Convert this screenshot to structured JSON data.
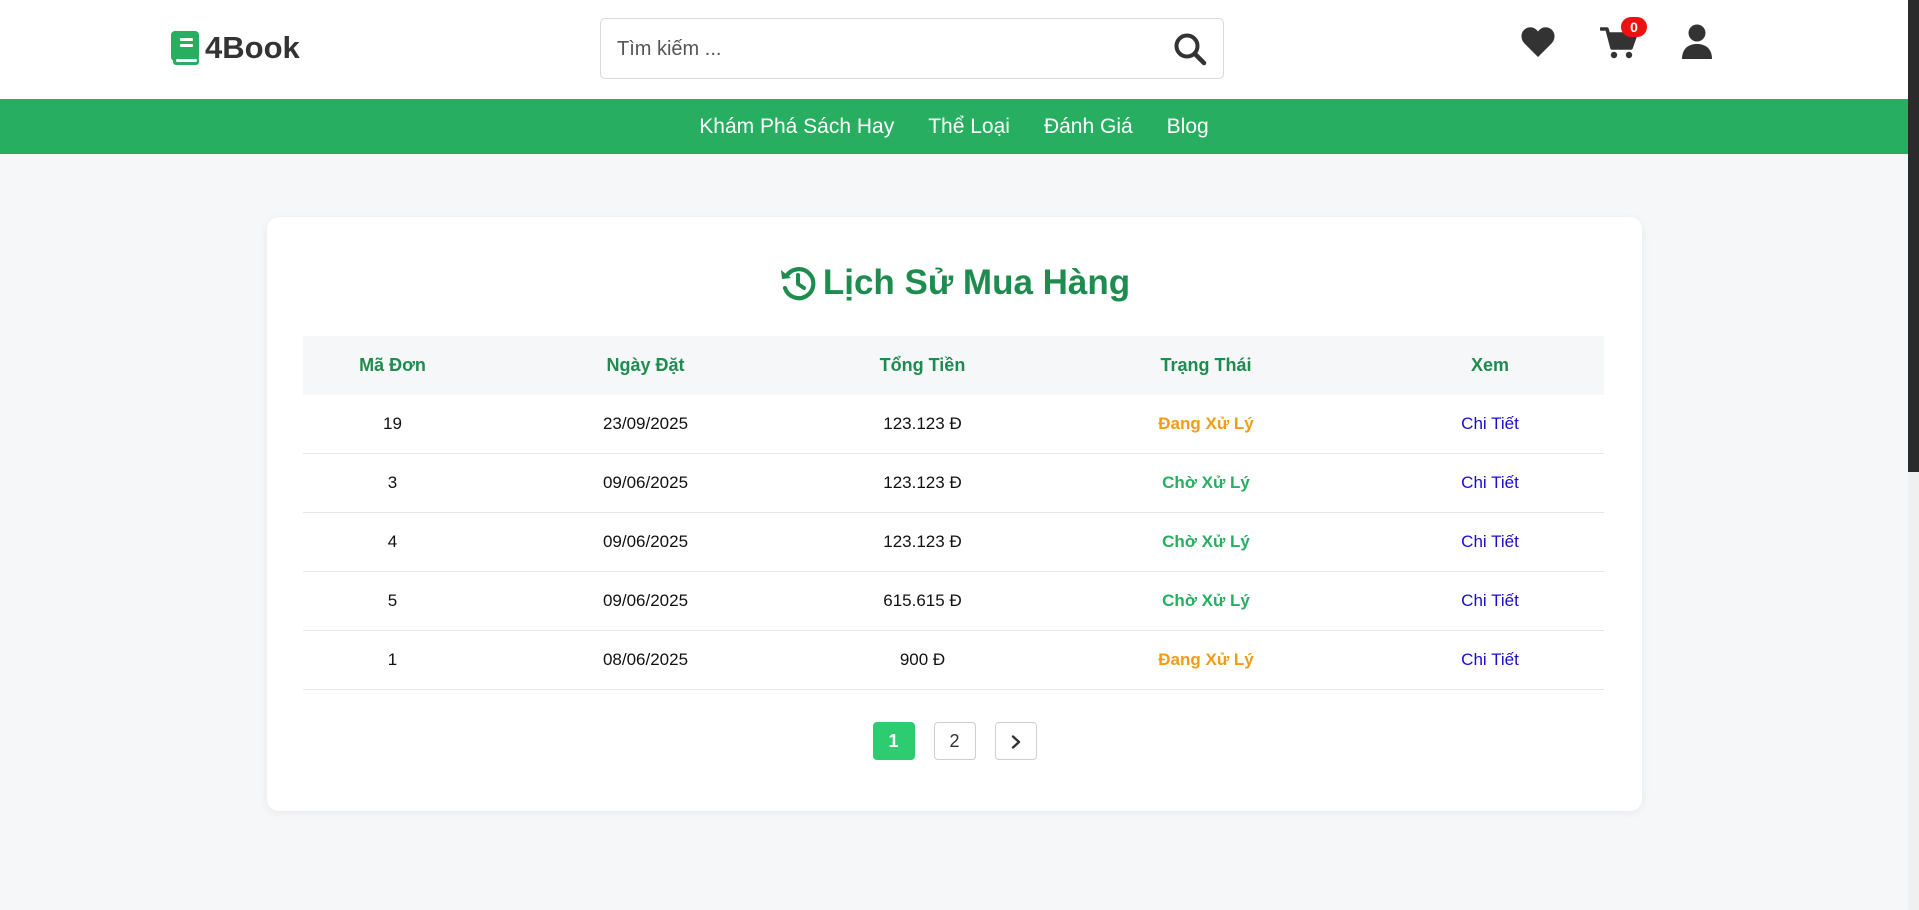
{
  "brand": {
    "name": "4Book",
    "color": "#27ae60"
  },
  "search": {
    "placeholder": "Tìm kiếm ...",
    "value": ""
  },
  "cart": {
    "count": "0",
    "badge_color": "#ee1111"
  },
  "header_icons": [
    "heart-icon",
    "cart-icon",
    "user-icon"
  ],
  "nav": {
    "items": [
      {
        "label": "Khám Phá Sách Hay"
      },
      {
        "label": "Thể Loại"
      },
      {
        "label": "Đánh Giá"
      },
      {
        "label": "Blog"
      }
    ]
  },
  "page": {
    "title": "Lịch Sử Mua Hàng",
    "title_icon": "history-icon",
    "title_color": "#1e8c4e"
  },
  "orders": {
    "columns": [
      "Mã Đơn",
      "Ngày Đặt",
      "Tổng Tiền",
      "Trạng Thái",
      "Xem"
    ],
    "rows": [
      {
        "id": "19",
        "date": "23/09/2025",
        "total": "123.123 Đ",
        "status": "Đang Xử Lý",
        "status_color": "#f39c12",
        "action": "Chi Tiết"
      },
      {
        "id": "3",
        "date": "09/06/2025",
        "total": "123.123 Đ",
        "status": "Chờ Xử Lý",
        "status_color": "#27ae60",
        "action": "Chi Tiết"
      },
      {
        "id": "4",
        "date": "09/06/2025",
        "total": "123.123 Đ",
        "status": "Chờ Xử Lý",
        "status_color": "#27ae60",
        "action": "Chi Tiết"
      },
      {
        "id": "5",
        "date": "09/06/2025",
        "total": "615.615 Đ",
        "status": "Chờ Xử Lý",
        "status_color": "#27ae60",
        "action": "Chi Tiết"
      },
      {
        "id": "1",
        "date": "08/06/2025",
        "total": "900 Đ",
        "status": "Đang Xử Lý",
        "status_color": "#f39c12",
        "action": "Chi Tiết"
      }
    ]
  },
  "pagination": {
    "pages": [
      "1",
      "2"
    ],
    "current": "1",
    "next_icon": "chevron-right-icon",
    "active_color": "#2ecc71"
  }
}
